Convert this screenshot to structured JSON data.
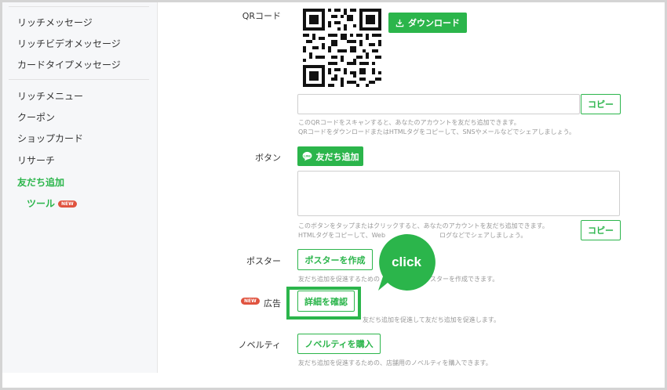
{
  "sidebar": {
    "items": [
      {
        "label": "リッチメッセージ"
      },
      {
        "label": "リッチビデオメッセージ"
      },
      {
        "label": "カードタイプメッセージ"
      },
      {
        "label": "リッチメニュー"
      },
      {
        "label": "クーポン"
      },
      {
        "label": "ショップカード"
      },
      {
        "label": "リサーチ"
      },
      {
        "label": "友だち追加"
      }
    ],
    "sub_item": {
      "label": "ツール",
      "badge": "NEW"
    }
  },
  "qr_section": {
    "label": "QRコード",
    "download_label": "ダウンロード",
    "copy_label": "コピー",
    "help_1": "このQRコードをスキャンすると、あなたのアカウントを友だち追加できます。",
    "help_2": "QRコードをダウンロードまたはHTMLタグをコピーして、SNSやメールなどでシェアしましょう。"
  },
  "button_section": {
    "label": "ボタン",
    "add_friend_label": "友だち追加",
    "copy_label": "コピー",
    "help_1": "このボタンをタップまたはクリックすると、あなたのアカウントを友だち追加できます。",
    "help_2_left": "HTMLタグをコピーして、Web",
    "help_2_right": "ログなどでシェアしましょう。"
  },
  "poster_section": {
    "label": "ポスター",
    "create_label": "ポスターを作成",
    "help_left": "友だち追加を促進するための",
    "help_right": "スターを作成できます。"
  },
  "ad_section": {
    "badge": "NEW",
    "label": "広告",
    "details_label": "詳細を確認",
    "help": "友だち追加を促進して友だち追加を促進します。"
  },
  "novelty_section": {
    "label": "ノベルティ",
    "buy_label": "ノベルティを購入",
    "help": "友だち追加を促進するための、店舗用のノベルティを購入できます。"
  },
  "callout": {
    "text": "click"
  },
  "colors": {
    "accent": "#2bb54b",
    "badge": "#e0533f"
  }
}
